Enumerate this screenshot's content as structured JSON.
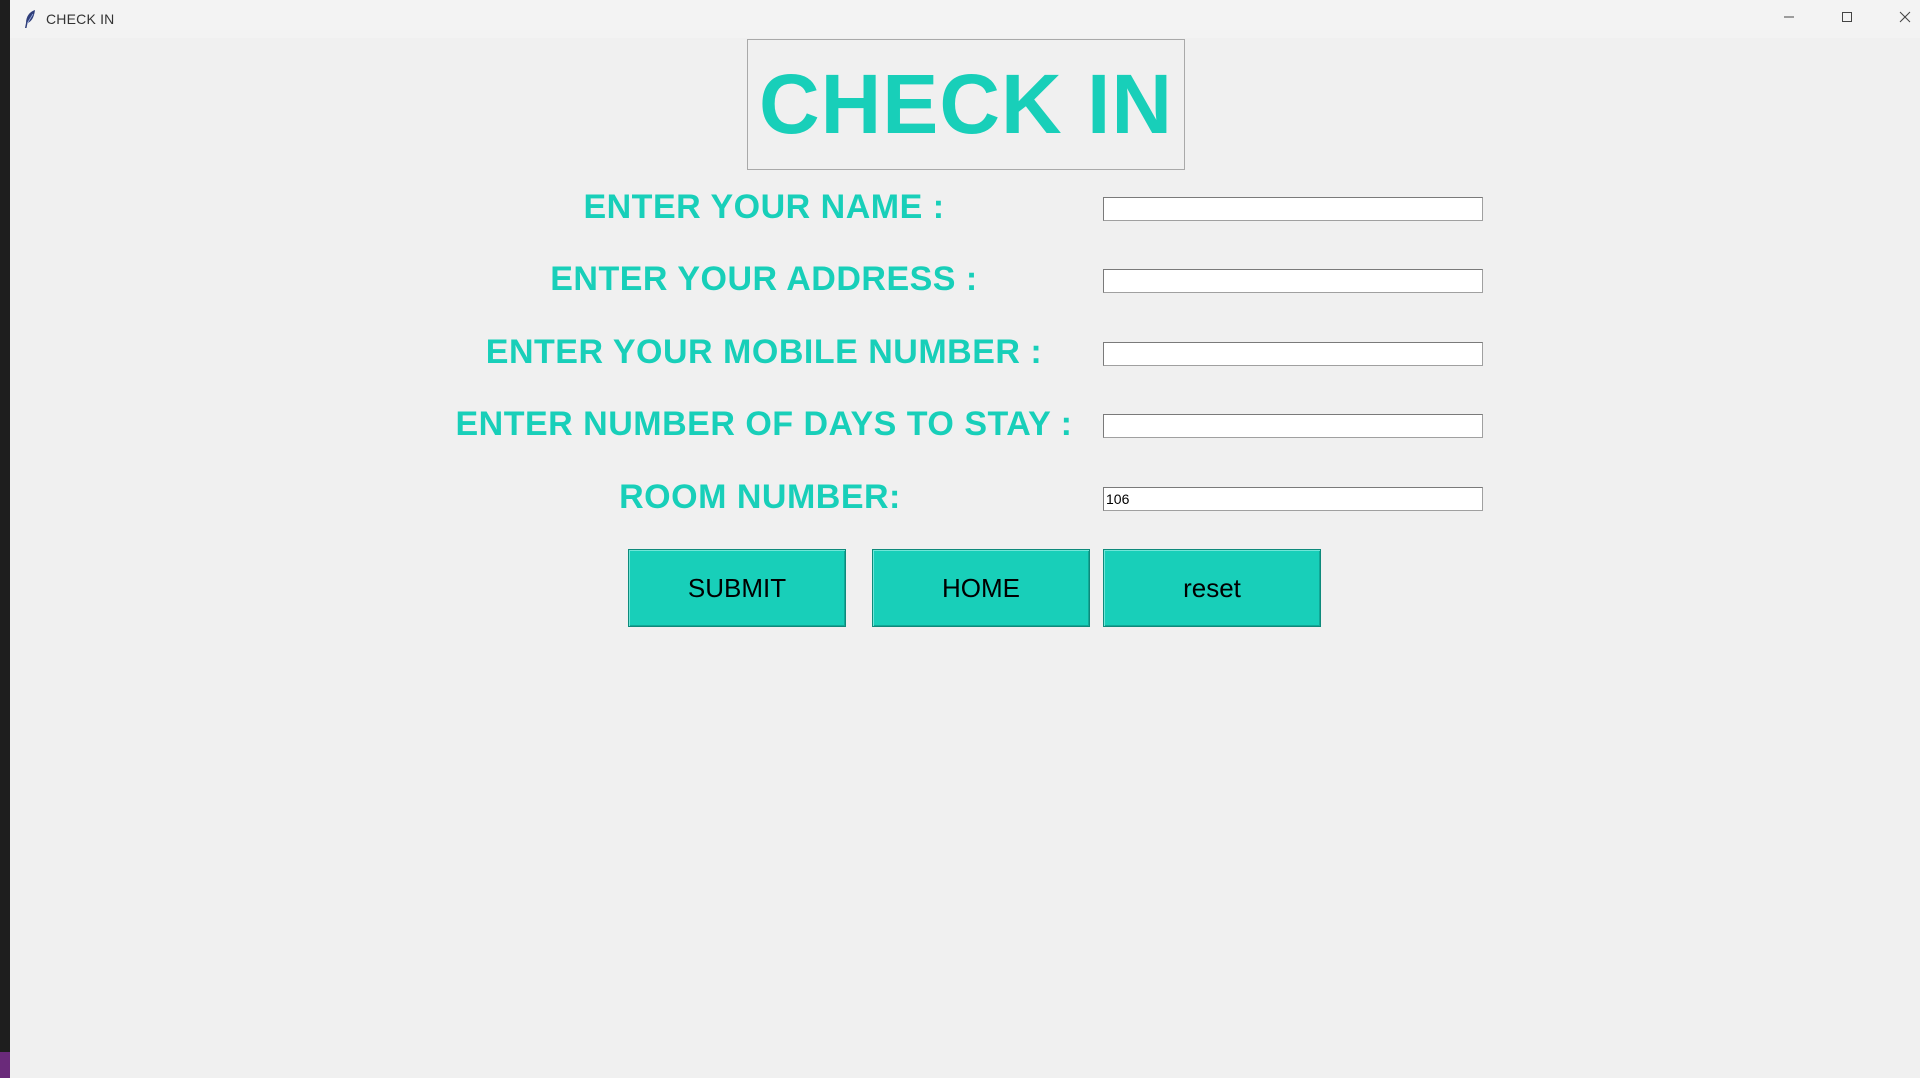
{
  "window": {
    "title": "CHECK IN",
    "app_icon": "feather-icon",
    "controls": [
      "minimize-icon",
      "maximize-icon",
      "close-icon"
    ]
  },
  "form": {
    "heading": "CHECK IN",
    "fields": [
      {
        "label": "ENTER YOUR NAME :",
        "value": ""
      },
      {
        "label": "ENTER YOUR ADDRESS :",
        "value": ""
      },
      {
        "label": "ENTER YOUR MOBILE NUMBER :",
        "value": ""
      },
      {
        "label": "ENTER NUMBER OF DAYS TO STAY :",
        "value": ""
      },
      {
        "label": "ROOM NUMBER:",
        "value": "106"
      }
    ],
    "buttons": {
      "submit": "SUBMIT",
      "home": "HOME",
      "reset": "reset"
    }
  },
  "colors": {
    "accent": "#18cfb9",
    "background": "#f0f0f0",
    "button_text": "#000000"
  }
}
